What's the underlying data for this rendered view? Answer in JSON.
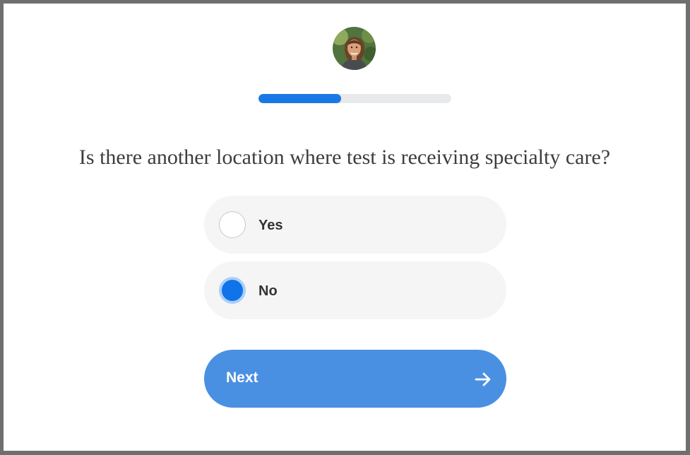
{
  "profile": {
    "avatar_icon": "person-photo-avatar"
  },
  "progress": {
    "fraction": 0.43,
    "color": "#1a78e6"
  },
  "question": {
    "text": "Is there another location where test is receiving specialty care?"
  },
  "options": [
    {
      "label": "Yes",
      "selected": false
    },
    {
      "label": "No",
      "selected": true
    }
  ],
  "next_button": {
    "label": "Next",
    "icon": "arrow-right-icon",
    "color": "#4a90e2"
  },
  "colors": {
    "accent": "#0f73ea",
    "option_background": "#f5f5f5",
    "text": "#3d3d3d"
  }
}
